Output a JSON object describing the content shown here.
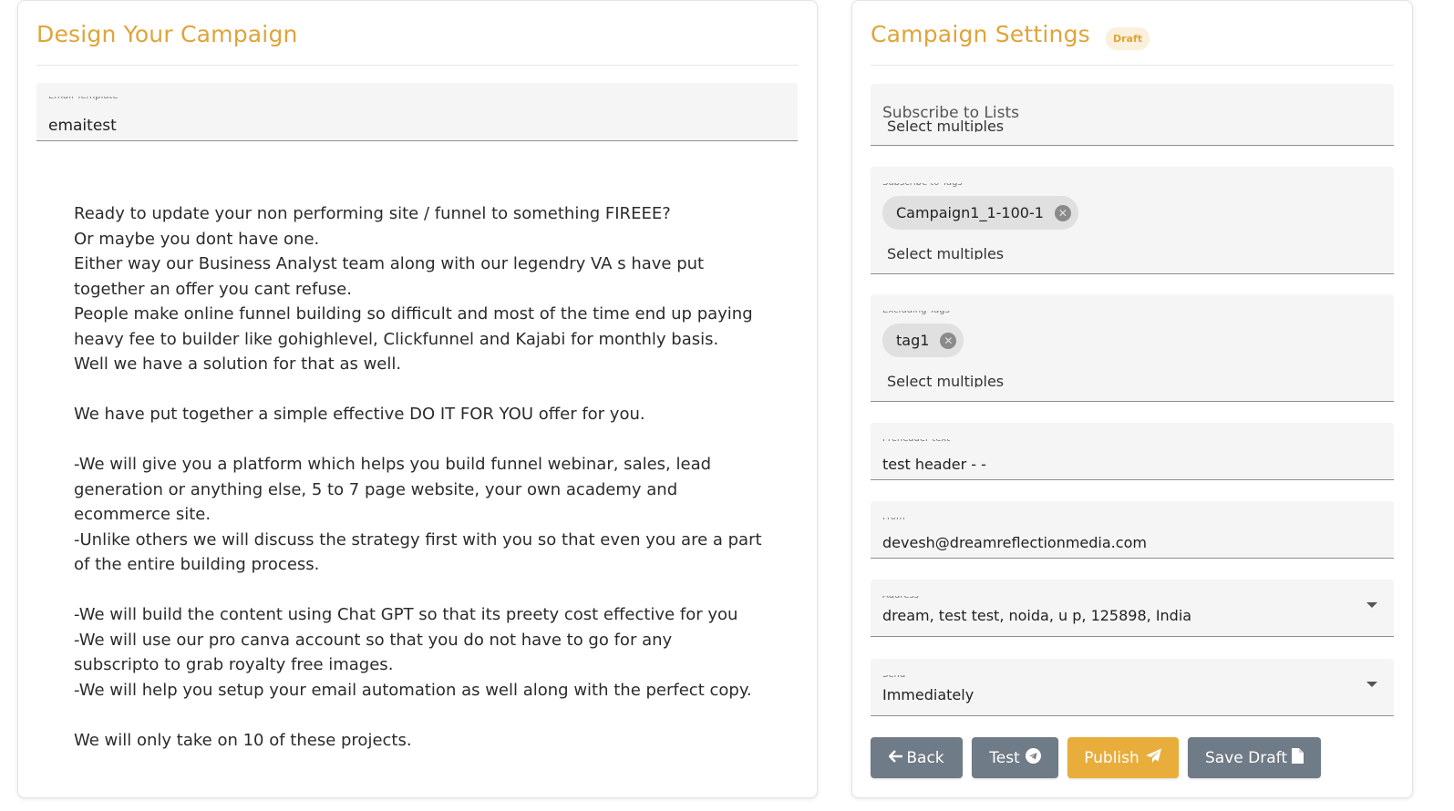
{
  "design": {
    "title": "Design Your Campaign",
    "template_field": {
      "label": "Email Template",
      "value": "emaitest"
    },
    "body_lines": [
      "Ready to update your non performing site / funnel to something FIREEE?",
      "Or maybe you dont have one.",
      "Either way our Business Analyst team along with our legendry VA s have put",
      "together an offer you cant refuse.",
      "People make online funnel building so difficult and most of the time end up paying",
      "heavy fee to builder like gohighlevel, Clickfunnel and Kajabi for monthly basis.",
      "Well we have a solution for that as well.",
      "",
      "We have put together a simple effective DO IT FOR YOU offer for you.",
      "",
      "-We will give you a platform which helps you build funnel webinar, sales, lead",
      "generation or anything else, 5 to 7 page website, your own academy and",
      "ecommerce site.",
      "-Unlike others we will discuss the strategy first with you so that even you are a part",
      "of the entire building process.",
      "",
      "-We will build the content using Chat GPT so that its preety cost effective for you",
      "-We will use our pro canva account so that you do not have to go for any",
      "subscripto  to grab royalty free images.",
      "-We will help you setup your email automation as well along with the perfect copy.",
      "",
      "We will only take on 10 of these projects."
    ]
  },
  "settings": {
    "title": "Campaign Settings",
    "badge": "Draft",
    "subscribe_lists": {
      "label": "Subscribe to Lists",
      "placeholder": "Select multiples"
    },
    "subscribe_tags": {
      "label": "Subscribe to Tags",
      "chip": "Campaign1_1-100-1",
      "placeholder": "Select multiples"
    },
    "excluding_tags": {
      "label": "Excluding Tags",
      "chip": "tag1",
      "placeholder": "Select multiples"
    },
    "preheader": {
      "label": "Preheader text",
      "value": "test header -  -"
    },
    "from": {
      "label": "From",
      "value": "devesh@dreamreflectionmedia.com"
    },
    "address": {
      "label": "Address",
      "value": "dream, test test, noida, u p, 125898, India"
    },
    "send": {
      "label": "Send",
      "value": "Immediately"
    },
    "buttons": {
      "back": "Back",
      "test": "Test",
      "publish": "Publish",
      "save_draft": "Save Draft"
    }
  },
  "colors": {
    "accent": "#e0a43a",
    "button_gray": "#6f7b86",
    "button_gold": "#e9ad3c"
  }
}
